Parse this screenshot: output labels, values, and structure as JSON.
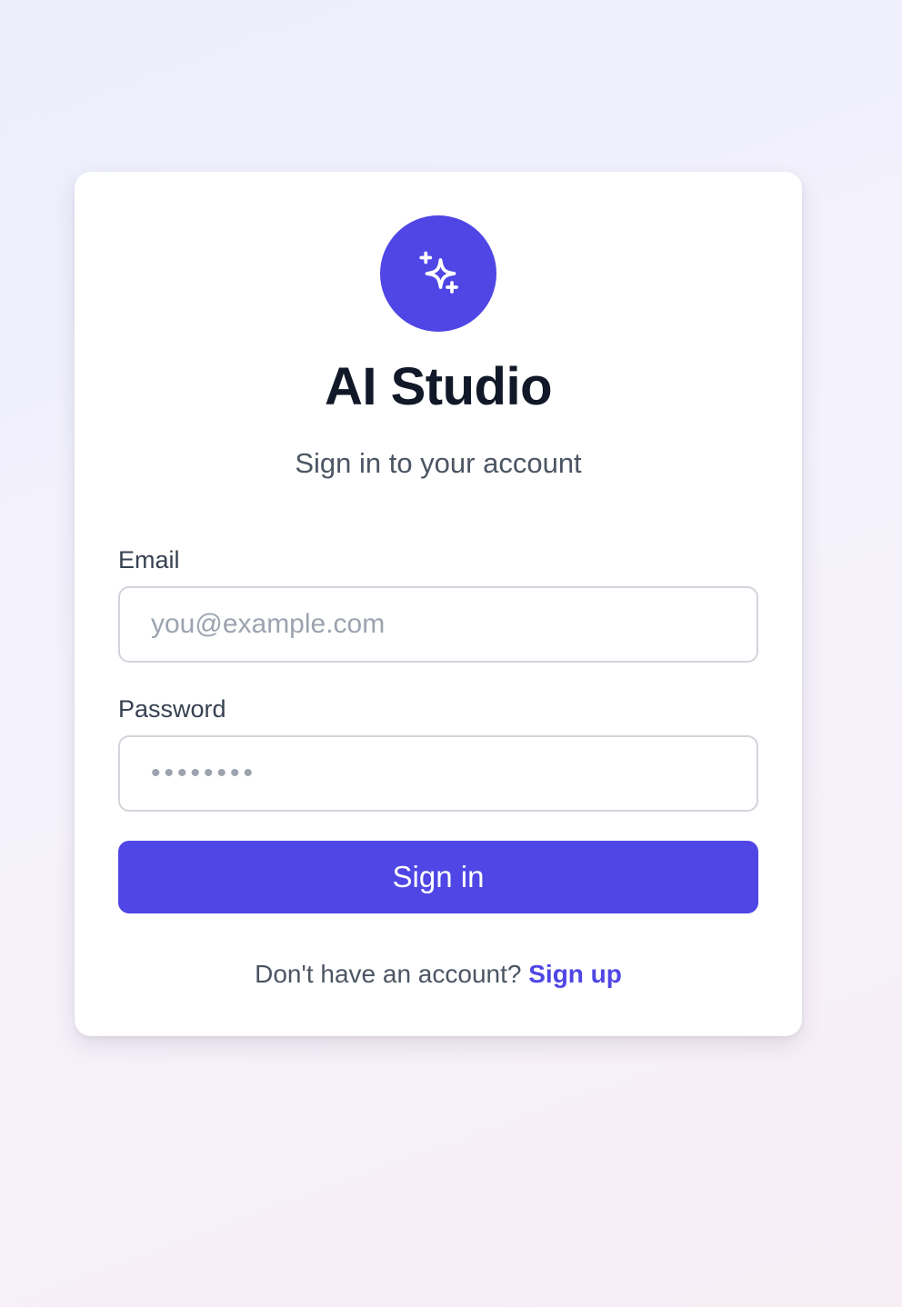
{
  "app": {
    "title": "AI Studio",
    "subtitle": "Sign in to your account",
    "logo_icon": "sparkles-icon"
  },
  "form": {
    "email_label": "Email",
    "email_placeholder": "you@example.com",
    "email_value": "",
    "password_label": "Password",
    "password_placeholder": "••••••••",
    "password_value": "",
    "submit_label": "Sign in"
  },
  "footer": {
    "prompt": "Don't have an account?",
    "link_label": "Sign up"
  },
  "colors": {
    "accent": "#4f46e5",
    "heading": "#111827",
    "muted_text": "#4b5563",
    "input_border": "#d1d5db"
  }
}
